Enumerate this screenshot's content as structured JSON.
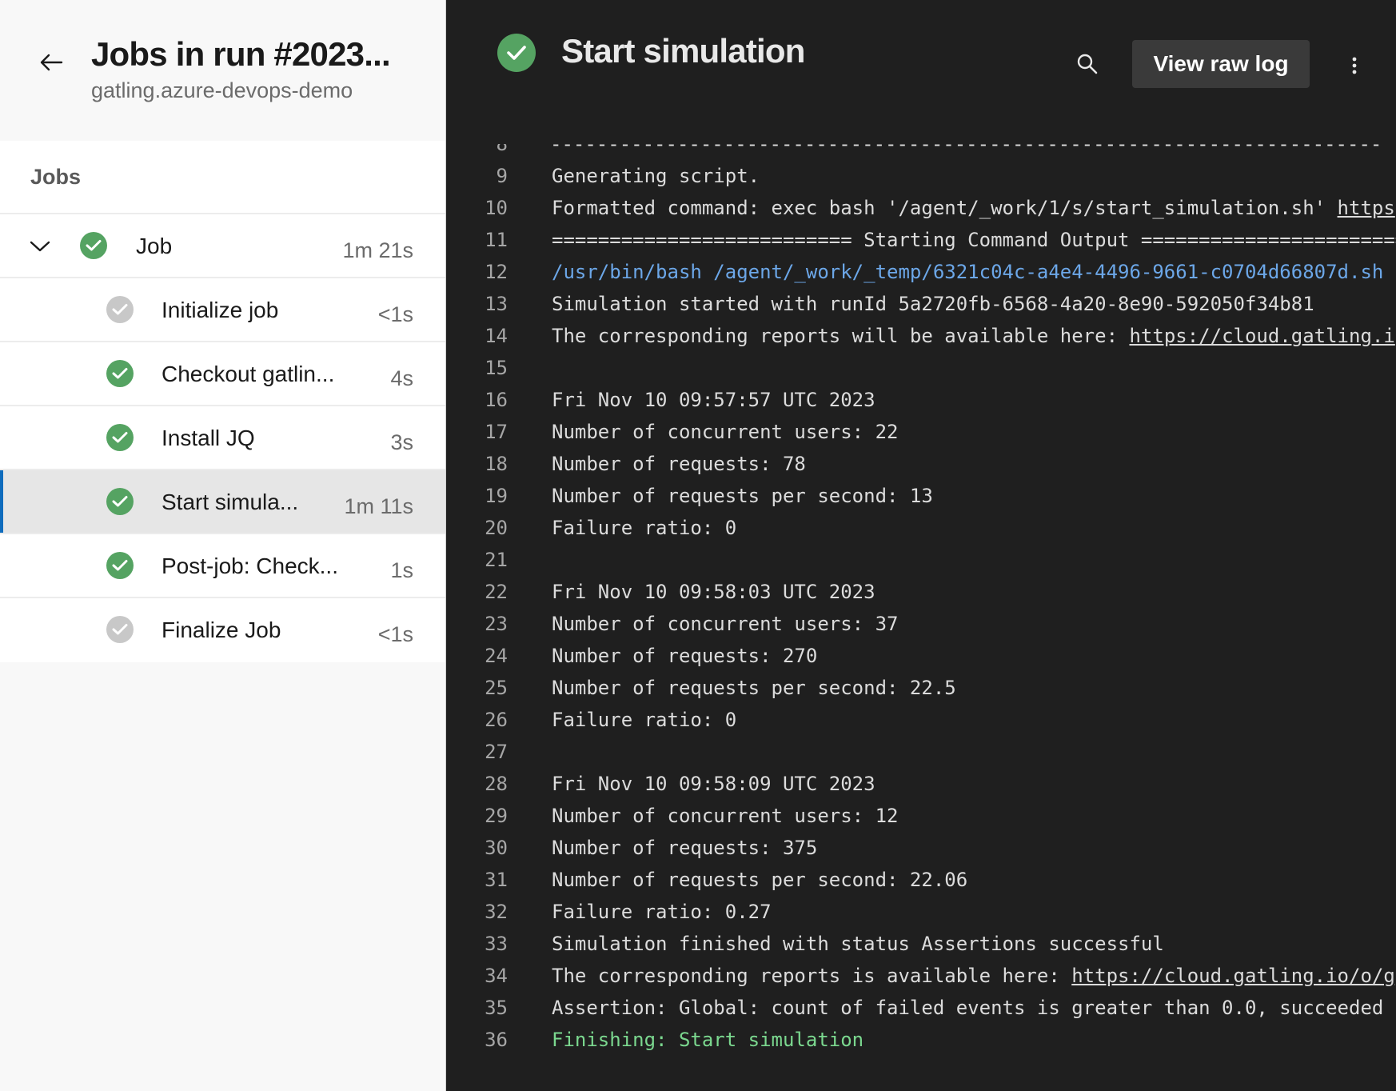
{
  "header": {
    "title": "Jobs in run #2023...",
    "subtitle": "gatling.azure-devops-demo"
  },
  "jobs": {
    "heading": "Jobs",
    "job": {
      "label": "Job",
      "duration": "1m 21s",
      "status": "succeeded"
    },
    "steps": [
      {
        "label": "Initialize job",
        "duration": "<1s",
        "status": "skipped"
      },
      {
        "label": "Checkout gatlin...",
        "duration": "4s",
        "status": "succeeded"
      },
      {
        "label": "Install JQ",
        "duration": "3s",
        "status": "succeeded"
      },
      {
        "label": "Start simula...",
        "duration": "1m 11s",
        "status": "succeeded",
        "selected": true
      },
      {
        "label": "Post-job: Check...",
        "duration": "1s",
        "status": "succeeded"
      },
      {
        "label": "Finalize Job",
        "duration": "<1s",
        "status": "skipped"
      }
    ]
  },
  "step_header": {
    "title": "Start simulation",
    "view_raw_log_label": "View raw log",
    "icons": [
      "check-icon",
      "search-icon",
      "more-vertical-icon"
    ]
  },
  "log": {
    "partial_top_line": "------------------------------------------------------------------------",
    "lines": [
      {
        "num": "9",
        "segments": [
          {
            "text": "Generating script."
          }
        ]
      },
      {
        "num": "10",
        "segments": [
          {
            "text": "Formatted command: exec bash '/agent/_work/1/s/start_simulation.sh' "
          },
          {
            "text": "https",
            "style": "link"
          }
        ]
      },
      {
        "num": "11",
        "segments": [
          {
            "text": "========================== Starting Command Output ========================"
          }
        ]
      },
      {
        "num": "12",
        "segments": [
          {
            "text": "/usr/bin/bash /agent/_work/_temp/6321c04c-a4e4-4496-9661-c0704d66807d.sh",
            "style": "blue"
          }
        ]
      },
      {
        "num": "13",
        "segments": [
          {
            "text": "Simulation started with runId 5a2720fb-6568-4a20-8e90-592050f34b81"
          }
        ]
      },
      {
        "num": "14",
        "segments": [
          {
            "text": "The corresponding reports will be available here: "
          },
          {
            "text": "https://cloud.gatling.i",
            "style": "link"
          }
        ]
      },
      {
        "num": "15",
        "segments": [
          {
            "text": ""
          }
        ]
      },
      {
        "num": "16",
        "segments": [
          {
            "text": "Fri Nov 10 09:57:57 UTC 2023"
          }
        ]
      },
      {
        "num": "17",
        "segments": [
          {
            "text": "Number of concurrent users: 22"
          }
        ]
      },
      {
        "num": "18",
        "segments": [
          {
            "text": "Number of requests: 78"
          }
        ]
      },
      {
        "num": "19",
        "segments": [
          {
            "text": "Number of requests per second: 13"
          }
        ]
      },
      {
        "num": "20",
        "segments": [
          {
            "text": "Failure ratio: 0"
          }
        ]
      },
      {
        "num": "21",
        "segments": [
          {
            "text": ""
          }
        ]
      },
      {
        "num": "22",
        "segments": [
          {
            "text": "Fri Nov 10 09:58:03 UTC 2023"
          }
        ]
      },
      {
        "num": "23",
        "segments": [
          {
            "text": "Number of concurrent users: 37"
          }
        ]
      },
      {
        "num": "24",
        "segments": [
          {
            "text": "Number of requests: 270"
          }
        ]
      },
      {
        "num": "25",
        "segments": [
          {
            "text": "Number of requests per second: 22.5"
          }
        ]
      },
      {
        "num": "26",
        "segments": [
          {
            "text": "Failure ratio: 0"
          }
        ]
      },
      {
        "num": "27",
        "segments": [
          {
            "text": ""
          }
        ]
      },
      {
        "num": "28",
        "segments": [
          {
            "text": "Fri Nov 10 09:58:09 UTC 2023"
          }
        ]
      },
      {
        "num": "29",
        "segments": [
          {
            "text": "Number of concurrent users: 12"
          }
        ]
      },
      {
        "num": "30",
        "segments": [
          {
            "text": "Number of requests: 375"
          }
        ]
      },
      {
        "num": "31",
        "segments": [
          {
            "text": "Number of requests per second: 22.06"
          }
        ]
      },
      {
        "num": "32",
        "segments": [
          {
            "text": "Failure ratio: 0.27"
          }
        ]
      },
      {
        "num": "33",
        "segments": [
          {
            "text": "Simulation finished with status Assertions successful"
          }
        ]
      },
      {
        "num": "34",
        "segments": [
          {
            "text": "The corresponding reports is available here: "
          },
          {
            "text": "https://cloud.gatling.io/o/g",
            "style": "link"
          }
        ]
      },
      {
        "num": "35",
        "segments": [
          {
            "text": "Assertion: Global: count of failed events is greater than 0.0, succeeded"
          }
        ]
      },
      {
        "num": "36",
        "segments": [
          {
            "text": "Finishing: Start simulation",
            "style": "green"
          }
        ]
      }
    ]
  },
  "colors": {
    "success": "#55a362",
    "skipped": "#c8c8c8",
    "selection_accent": "#0f6cbd",
    "log_link_blue": "#6ca7e8",
    "log_finish_green": "#7bd88f"
  }
}
